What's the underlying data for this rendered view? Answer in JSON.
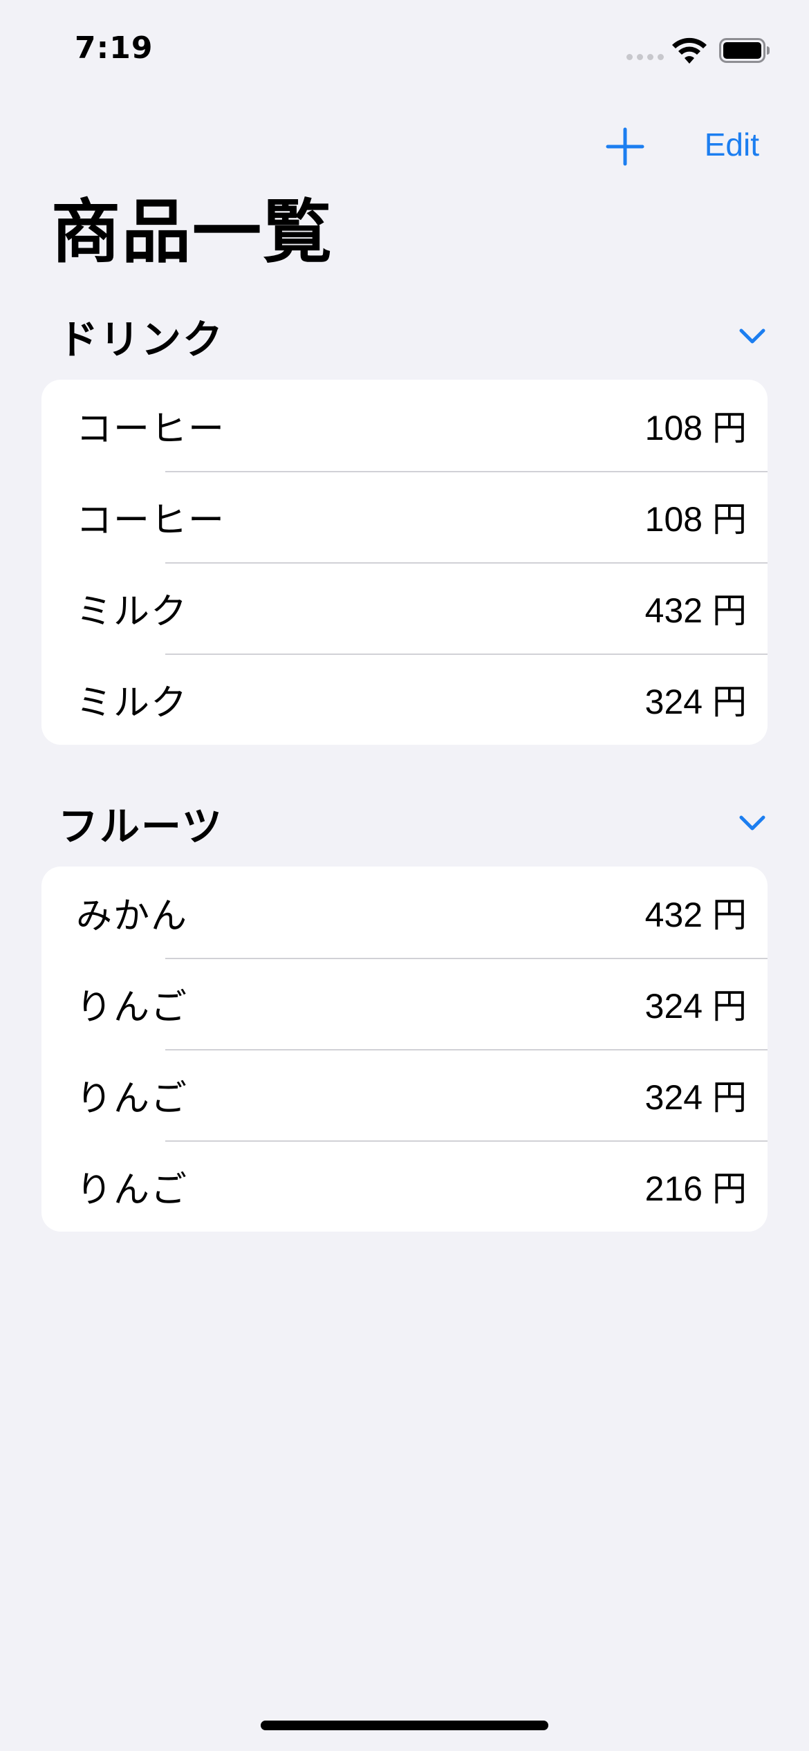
{
  "status_bar": {
    "time": "7:19"
  },
  "nav": {
    "edit_label": "Edit",
    "add_icon": "plus-icon"
  },
  "title": "商品一覧",
  "sections": [
    {
      "title": "ドリンク",
      "chevron_icon": "chevron-down-icon",
      "items": [
        {
          "name": "コーヒー",
          "price": "108 円"
        },
        {
          "name": "コーヒー",
          "price": "108 円"
        },
        {
          "name": "ミルク",
          "price": "432 円"
        },
        {
          "name": "ミルク",
          "price": "324 円"
        }
      ]
    },
    {
      "title": "フルーツ",
      "chevron_icon": "chevron-down-icon",
      "items": [
        {
          "name": "みかん",
          "price": "432 円"
        },
        {
          "name": "りんご",
          "price": "324 円"
        },
        {
          "name": "りんご",
          "price": "324 円"
        },
        {
          "name": "りんご",
          "price": "216 円"
        }
      ]
    }
  ],
  "colors": {
    "accent": "#1C7EF0",
    "background": "#F2F2F7",
    "card": "#FFFFFF",
    "separator": "#D1D1D6"
  }
}
